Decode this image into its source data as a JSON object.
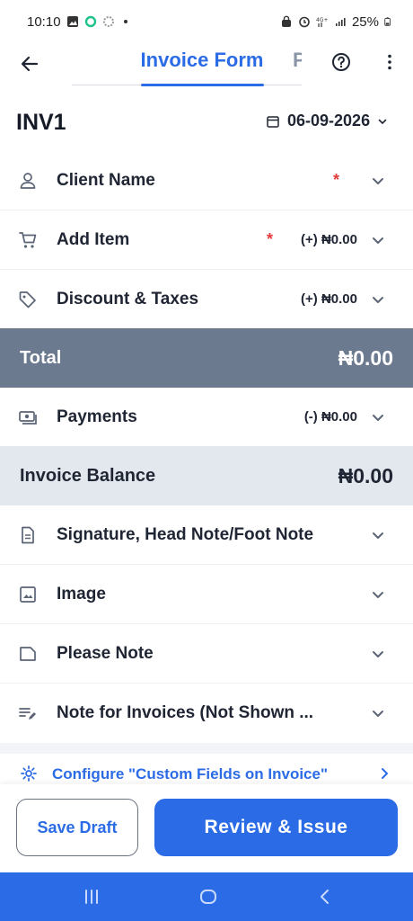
{
  "status_bar": {
    "time": "10:10",
    "battery": "25%"
  },
  "header": {
    "title": "Invoice Form",
    "next_tab": "P"
  },
  "invoice": {
    "number": "INV1",
    "date": "06-09-2026"
  },
  "rows": [
    {
      "label": "Client Name",
      "required": "*",
      "amount": ""
    },
    {
      "label": "Add Item",
      "required": "*",
      "amount": "(+) ₦0.00"
    },
    {
      "label": "Discount & Taxes",
      "required": "",
      "amount": "(+) ₦0.00"
    },
    {
      "label": "Payments",
      "required": "",
      "amount": "(-) ₦0.00"
    },
    {
      "label": "Signature, Head Note/Foot Note",
      "required": "",
      "amount": ""
    },
    {
      "label": "Image",
      "required": "",
      "amount": ""
    },
    {
      "label": "Please Note",
      "required": "",
      "amount": ""
    },
    {
      "label": "Note for Invoices (Not Shown ...",
      "required": "",
      "amount": ""
    }
  ],
  "total": {
    "label": "Total",
    "value": "₦0.00"
  },
  "balance": {
    "label": "Invoice Balance",
    "value": "₦0.00"
  },
  "config_link": "Configure \"Custom Fields on Invoice\"",
  "buttons": {
    "save_draft": "Save Draft",
    "review_issue": "Review & Issue"
  },
  "colors": {
    "accent": "#2b6be6",
    "total_band": "#6b7a8f",
    "balance_band": "#e3e8ef",
    "required": "#e23b3b"
  }
}
